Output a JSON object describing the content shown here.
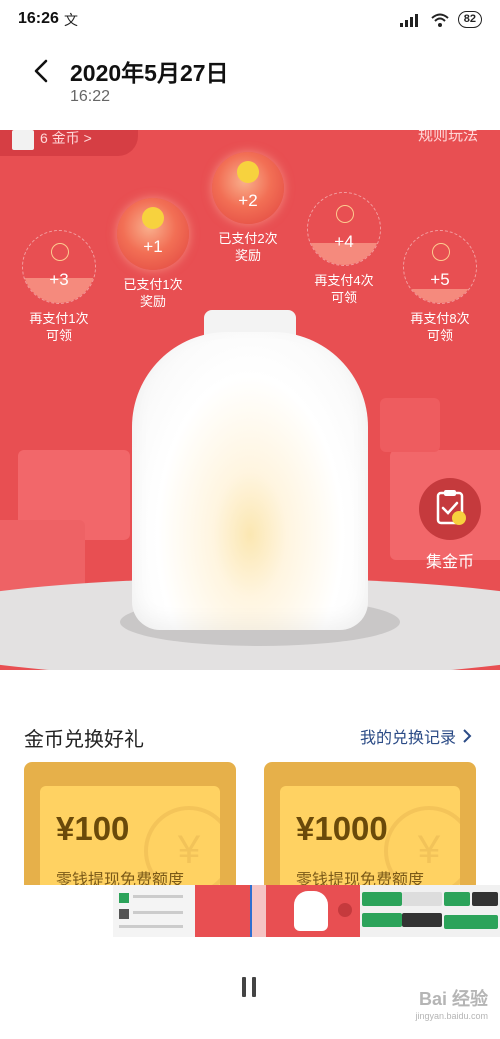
{
  "status_bar": {
    "time": "16:26",
    "extra_icon_text": "文",
    "battery": "82",
    "icons": [
      "signal-icon",
      "wifi-icon",
      "battery-icon"
    ]
  },
  "header": {
    "back_icon": "chevron-left-icon",
    "title": "2020年5月27日",
    "subtitle": "16:22"
  },
  "top_bar": {
    "coin_label": "6 金币 >",
    "rules_label": "规则玩法"
  },
  "milestones": [
    {
      "value": "+3",
      "label_line1": "再支付1次",
      "label_line2": "可领",
      "status": "partial",
      "fill": 0.35
    },
    {
      "value": "+1",
      "label_line1": "已支付1次",
      "label_line2": "奖励",
      "status": "done",
      "fill": 1.0
    },
    {
      "value": "+2",
      "label_line1": "已支付2次",
      "label_line2": "奖励",
      "status": "done",
      "fill": 1.0
    },
    {
      "value": "+4",
      "label_line1": "再支付4次",
      "label_line2": "可领",
      "status": "partial",
      "fill": 0.3
    },
    {
      "value": "+5",
      "label_line1": "再支付8次",
      "label_line2": "可领",
      "status": "partial",
      "fill": 0.2
    }
  ],
  "collect_button": {
    "label": "集金币",
    "icon": "clipboard-check-icon"
  },
  "exchange": {
    "title": "金币兑换好礼",
    "history_link": "我的兑换记录",
    "cards": [
      {
        "amount": "¥100",
        "desc": "零钱提现免费额度"
      },
      {
        "amount": "¥1000",
        "desc": "零钱提现免费额度"
      }
    ]
  },
  "colors": {
    "accent_red": "#e84f52",
    "card_gold": "#ffd262",
    "link_blue": "#2b4b86"
  },
  "player": {
    "pause_icon": "pause-icon"
  },
  "watermark": {
    "main": "Bai 经验",
    "sub": "jingyan.baidu.com"
  }
}
